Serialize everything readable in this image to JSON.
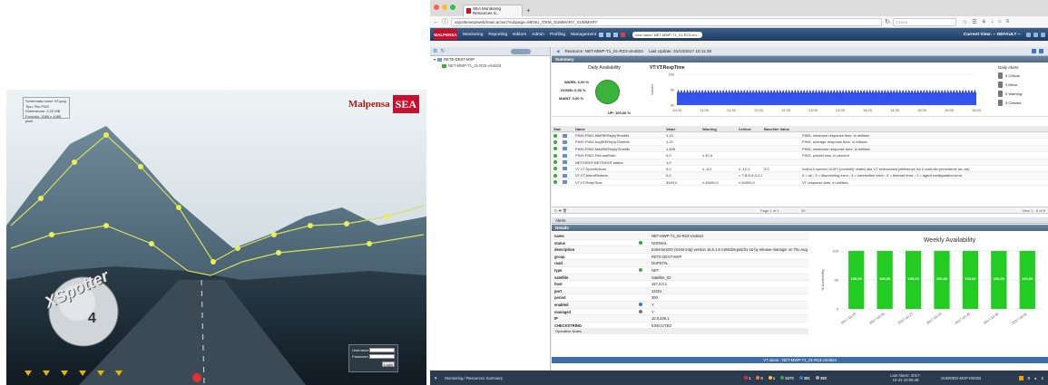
{
  "login_screen": {
    "info_lines": [
      "Schermata home XS.png",
      "Tipo: File PNG",
      "Dimensione: 2,22 MB",
      "Formato: 1084 x 1085 pixel"
    ],
    "brand_name": "Malpensa",
    "brand_mark": "SEA",
    "product_logo": "XSpotter",
    "product_version": "4",
    "username_label": "Username",
    "password_label": "Password",
    "login_button": "Login"
  },
  "browser": {
    "tab_title": "SEA Monitoring Resources S...",
    "url": "xspotterwsp/web/main.action?subpage=MENU_ITEM_SUMMARY_SUMMARY",
    "search_placeholder": "Cerca"
  },
  "app": {
    "logo": "MALPENSA",
    "menu": [
      "Monitoring",
      "Reporting",
      "Editors",
      "Admin",
      "Profiling",
      "Management"
    ],
    "host_selector": "new name: NET-MWP-T1_01-R23-vm...",
    "current_view": "Current View: -- DEFAULT --"
  },
  "tree": {
    "root": "RETE-DEST-MXP",
    "child": "NET-MWP-T1_01-R23-vm4624"
  },
  "resource_header": {
    "resource": "Resource: NET-MWP-T1_01-R23-vm4624",
    "last_update": "Last Update: 31/10/2017 10:11:28"
  },
  "summary": {
    "section": "Summary",
    "availability_title": "Daily Availability",
    "warn": "WARN: 0,00 %",
    "down": "DOWN: 0,00 %",
    "maint": "MAINT: 0,00 %",
    "up": "UP: 100,00 %",
    "chart_title": "VT:VT.RespTime",
    "chart_ylabel": "Values",
    "chart_yticks": [
      "10k",
      "5k",
      "0k"
    ],
    "chart_xticks": [
      "10:30",
      "11:00",
      "11:30",
      "12:00",
      "12:30",
      "13:00",
      "13:30",
      "14:00",
      "14:30",
      "15:00",
      "15:30",
      "16:00"
    ],
    "daily_alerts_title": "Daily Alerts",
    "alerts": [
      "0 Critical",
      "0 Minor",
      "0 Warning",
      "0 Cleared"
    ]
  },
  "table": {
    "headers": [
      "Status",
      "Name",
      "",
      "Value",
      "Warning",
      "Critical",
      "Baseline Value",
      ""
    ],
    "rows": [
      {
        "name": "PING.PING.MinRtEReplyTimeMs",
        "value": "1,13",
        "warning": "",
        "critical": "",
        "baseline": "",
        "desc": "PING, minimum response time, in millisec"
      },
      {
        "name": "PING.PING.AvgRtEReplyTimeMs",
        "value": "1,22",
        "warning": "",
        "critical": "",
        "baseline": "",
        "desc": "PING, average response time, in millisec"
      },
      {
        "name": "PING.PING.MaxRtEReplyTimeMs",
        "value": "1,406",
        "warning": "",
        "critical": "",
        "baseline": "",
        "desc": "PING, maximum response time, in millisec"
      },
      {
        "name": "PING.PING.PktLossRate",
        "value": "0,0",
        "warning": "≥ 40,0",
        "critical": "",
        "baseline": "",
        "desc": "PING, packet loss, in percent"
      },
      {
        "name": "NETSIGHT.NETSIGHT.status",
        "value": "1,0",
        "warning": "",
        "critical": "",
        "baseline": "",
        "desc": ""
      },
      {
        "name": "VT.VT.SpecificNum",
        "value": "5,0",
        "warning": "≤ -6,0",
        "critical": "≤ -12,0",
        "baseline": "5,0",
        "desc": "Indica il numero di API (controlli) relativi alla VT selezionata (differenze tra il controllo precedente ad ora)"
      },
      {
        "name": "VT.VT.AlarmReason",
        "value": "0,0",
        "warning": "",
        "critical": "= 7-8-5-4-3-2-1",
        "baseline": "",
        "desc": "0 = ok ; 3 = discovering error ; 4 = connection error ; 6 = timeout error ; 1 = agent configuration error"
      },
      {
        "name": "VT.VT.RespTime",
        "value": "3943,0",
        "warning": "≥ 45000,0",
        "critical": "≥ 54000,0",
        "baseline": "",
        "desc": "VT response time, in millisec"
      }
    ],
    "pager": "Page 1 of 1",
    "page_size": "30",
    "view_count": "View 1 - 8 of 8"
  },
  "alerts_section": "Alerts",
  "details_section": "Details",
  "details": [
    {
      "k": "name",
      "icon": "",
      "v": "NET-MWP-T1_01-R23-vm4624"
    },
    {
      "k": "status",
      "icon": "green",
      "v": "NORMAL"
    },
    {
      "k": "description",
      "icon": "",
      "v": "ExtremeXOS (X440-24p) version 15.5.1.6 v1551b6-patch1-16 by release-manager on Thu Aug 6"
    },
    {
      "k": "group",
      "icon": "",
      "v": "RETE-DEST-MXP"
    },
    {
      "k": "road",
      "icon": "",
      "v": "DUPSTAL"
    },
    {
      "k": "type",
      "icon": "type",
      "v": "NET"
    },
    {
      "k": "satellite",
      "icon": "",
      "v": "Satellite_02"
    },
    {
      "k": "host",
      "icon": "",
      "v": "157.0.0.1"
    },
    {
      "k": "port",
      "icon": "",
      "v": "12201"
    },
    {
      "k": "period",
      "icon": "",
      "v": "300"
    },
    {
      "k": "enabled",
      "icon": "enabled",
      "v": "Y"
    },
    {
      "k": "managed",
      "icon": "managed",
      "v": "Y"
    },
    {
      "k": "IP",
      "icon": "",
      "v": "10.0.239.1"
    },
    {
      "k": "CHECKSTRING",
      "icon": "",
      "v": "EXECUTED"
    }
  ],
  "operative_notes": "Operative Notes",
  "vt_name": "VT name : NET-MWP-T1_01-R23-vm4624",
  "weekly": {
    "title": "Weekly Availability",
    "ylabel": "% Availability",
    "yticks": [
      "100",
      "50",
      "0"
    ]
  },
  "chart_data": [
    {
      "type": "line",
      "title": "VT:VT.RespTime",
      "ylabel": "Values",
      "ylim": [
        0,
        10000
      ],
      "x": [
        "10:30",
        "11:00",
        "11:30",
        "12:00",
        "12:30",
        "13:00",
        "13:30",
        "14:00",
        "14:30",
        "15:00",
        "15:30",
        "16:00"
      ],
      "series": [
        {
          "values": [
            4000,
            4000,
            4000,
            4000,
            4000,
            4000,
            4000,
            4000,
            4000,
            4000,
            4000,
            4000
          ]
        }
      ]
    },
    {
      "type": "bar",
      "title": "Weekly Availability",
      "ylabel": "% Availability",
      "ylim": [
        0,
        100
      ],
      "categories": [
        "2017-10-25",
        "2017-10-26",
        "2017-10-27",
        "2017-10-28",
        "2017-10-29",
        "2017-10-30",
        "2017-10-31"
      ],
      "values": [
        100,
        100,
        100,
        100,
        100,
        100,
        100
      ],
      "value_labels": [
        "100,00",
        "100,00",
        "100,00",
        "100,00",
        "100,00",
        "100,00",
        "100,00"
      ]
    }
  ],
  "statusbar": {
    "title": "Monitoring / Resources Summary",
    "counts": [
      "1",
      "0",
      "1",
      "3370",
      "381",
      "380"
    ],
    "last_alarm": "Last Alarm: 2017-10-31 10:06:48",
    "host": "SUMOBO-MXP-I00SIB",
    "r1": "0",
    "r2": "1"
  }
}
